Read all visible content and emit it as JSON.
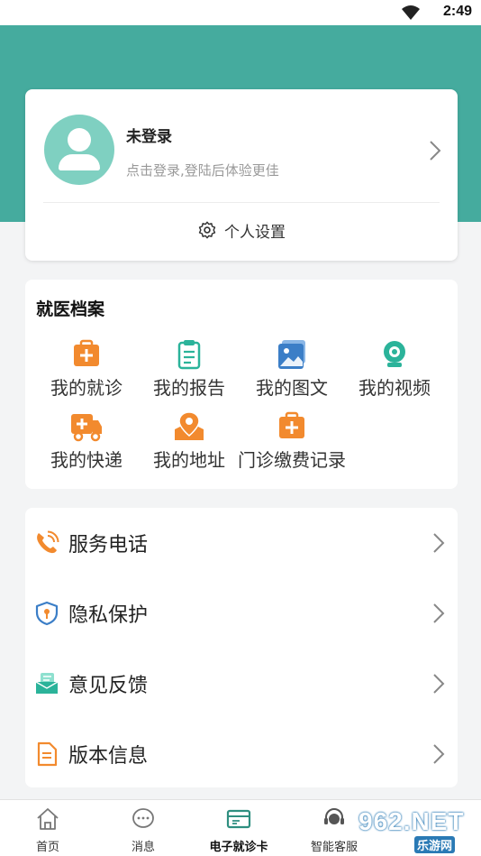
{
  "status_bar": {
    "time": "2:49",
    "icons": [
      "wifi-icon"
    ]
  },
  "profile": {
    "name": "未登录",
    "hint": "点击登录,登陆后体验更佳",
    "settings_label": "个人设置",
    "avatar_icon": "user-icon"
  },
  "records": {
    "title": "就医档案",
    "items": [
      {
        "label": "我的就诊",
        "icon": "medical-case-icon"
      },
      {
        "label": "我的报告",
        "icon": "clipboard-icon"
      },
      {
        "label": "我的图文",
        "icon": "image-icon"
      },
      {
        "label": "我的视频",
        "icon": "camera-icon"
      },
      {
        "label": "我的快递",
        "icon": "delivery-truck-icon"
      },
      {
        "label": "我的地址",
        "icon": "location-pin-icon"
      },
      {
        "label": "门诊缴费记录",
        "icon": "medical-case-icon"
      }
    ]
  },
  "menu": {
    "items": [
      {
        "label": "服务电话",
        "icon": "phone-icon"
      },
      {
        "label": "隐私保护",
        "icon": "shield-icon"
      },
      {
        "label": "意见反馈",
        "icon": "feedback-icon"
      },
      {
        "label": "版本信息",
        "icon": "document-icon"
      }
    ]
  },
  "tabs": [
    {
      "label": "首页",
      "icon": "home-icon"
    },
    {
      "label": "消息",
      "icon": "message-icon"
    },
    {
      "label": "电子就诊卡",
      "icon": "card-icon"
    },
    {
      "label": "智能客服",
      "icon": "service-icon"
    }
  ],
  "watermark": {
    "text": "962.NET",
    "sub": "乐游网"
  },
  "colors": {
    "header": "#45ab9e",
    "orange": "#f28a2e",
    "teal": "#2bb39a",
    "blue": "#3b7ec7"
  }
}
